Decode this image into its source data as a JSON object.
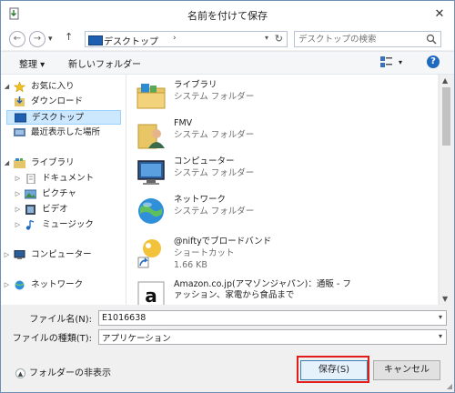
{
  "window": {
    "title": "名前を付けて保存",
    "close_glyph": "✕"
  },
  "navbar": {
    "back_glyph": "←",
    "forward_glyph": "→",
    "recent_glyph": "▾",
    "up_glyph": "↑",
    "address": "デスクトップ",
    "address_chevron": "›",
    "address_dropdown_glyph": "▾",
    "refresh_glyph": "↻",
    "search_placeholder": "デスクトップの検索"
  },
  "toolbar": {
    "organize": "整理 ▾",
    "new_folder": "新しいフォルダー",
    "view_dropdown_glyph": "▾",
    "help_glyph": "?"
  },
  "nav_pane": {
    "items": [
      {
        "label": "お気に入り",
        "expander": "◢",
        "icon": "star-icon"
      },
      {
        "label": "ダウンロード",
        "expander": "",
        "icon": "download-icon"
      },
      {
        "label": "デスクトップ",
        "expander": "",
        "icon": "desktop-icon",
        "selected": true
      },
      {
        "label": "最近表示した場所",
        "expander": "",
        "icon": "recent-places-icon"
      },
      {
        "label": "ライブラリ",
        "expander": "◢",
        "icon": "library-icon"
      },
      {
        "label": "ドキュメント",
        "expander": "▷",
        "icon": "documents-icon"
      },
      {
        "label": "ピクチャ",
        "expander": "▷",
        "icon": "pictures-icon"
      },
      {
        "label": "ビデオ",
        "expander": "▷",
        "icon": "videos-icon"
      },
      {
        "label": "ミュージック",
        "expander": "▷",
        "icon": "music-icon"
      },
      {
        "label": "コンピューター",
        "expander": "▷",
        "icon": "computer-icon"
      },
      {
        "label": "ネットワーク",
        "expander": "▷",
        "icon": "network-icon"
      }
    ]
  },
  "content": {
    "items": [
      {
        "name": "ライブラリ",
        "sub": "システム フォルダー",
        "icon": "library-folder-icon"
      },
      {
        "name": "FMV",
        "sub": "システム フォルダー",
        "icon": "user-folder-icon"
      },
      {
        "name": "コンピューター",
        "sub": "システム フォルダー",
        "icon": "computer-icon"
      },
      {
        "name": "ネットワーク",
        "sub": "システム フォルダー",
        "icon": "network-globe-icon"
      },
      {
        "name": "@niftyでブロードバンド",
        "sub": "ショートカット",
        "sub2": "1.66 KB",
        "icon": "nifty-shortcut-icon"
      },
      {
        "name": "Amazon.co.jp(アマゾンジャパン)：通販 - ファッション、家電から食品まで",
        "sub": "",
        "icon": "amazon-icon"
      }
    ]
  },
  "form": {
    "filename_label": "ファイル名(N):",
    "filename_value": "E1016638",
    "filetype_label": "ファイルの種類(T):",
    "filetype_value": "アプリケーション",
    "dropdown_glyph": "▾"
  },
  "bottom": {
    "hide_folders_glyph": "▲",
    "hide_folders": "フォルダーの非表示",
    "save": "保存(S)",
    "cancel": "キャンセル",
    "resize_glyph": "◢"
  },
  "colors": {
    "highlight": "#e21b1b",
    "selection": "#cce8ff",
    "accent": "#1e6ac0"
  }
}
